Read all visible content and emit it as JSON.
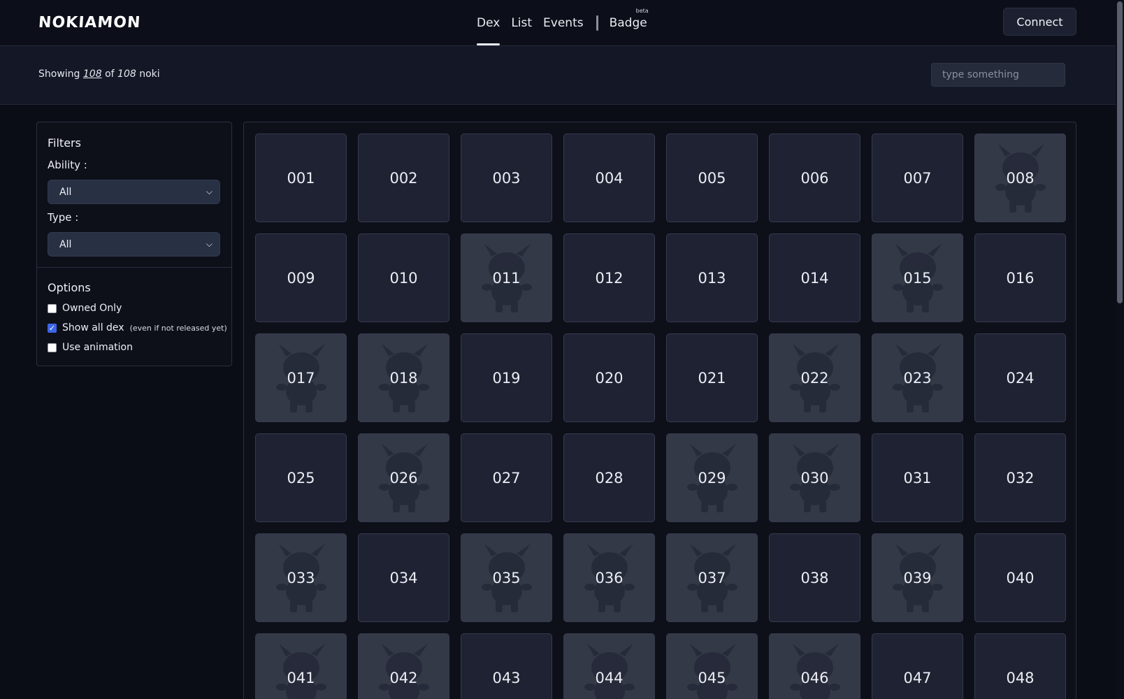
{
  "header": {
    "logo": "NOKIAMON",
    "nav": [
      {
        "label": "Dex",
        "active": true
      },
      {
        "label": "List",
        "active": false
      },
      {
        "label": "Events",
        "active": false
      }
    ],
    "badge_label": "Badge",
    "badge_tag": "beta",
    "connect_label": "Connect"
  },
  "subbar": {
    "showing_prefix": "Showing",
    "shown_count": "108",
    "of_word": "of",
    "total_count": "108",
    "unit": "noki",
    "search_placeholder": "type something"
  },
  "filters": {
    "title": "Filters",
    "ability_label": "Ability :",
    "ability_value": "All",
    "type_label": "Type :",
    "type_value": "All",
    "options_title": "Options",
    "options": [
      {
        "label": "Owned Only",
        "checked": false,
        "note": ""
      },
      {
        "label": "Show all dex",
        "checked": true,
        "note": "(even if not released yet)"
      },
      {
        "label": "Use animation",
        "checked": false,
        "note": ""
      }
    ]
  },
  "cards": [
    {
      "num": "001",
      "silhouette": false
    },
    {
      "num": "002",
      "silhouette": false
    },
    {
      "num": "003",
      "silhouette": false
    },
    {
      "num": "004",
      "silhouette": false
    },
    {
      "num": "005",
      "silhouette": false
    },
    {
      "num": "006",
      "silhouette": false
    },
    {
      "num": "007",
      "silhouette": false
    },
    {
      "num": "008",
      "silhouette": true
    },
    {
      "num": "009",
      "silhouette": false
    },
    {
      "num": "010",
      "silhouette": false
    },
    {
      "num": "011",
      "silhouette": true
    },
    {
      "num": "012",
      "silhouette": false
    },
    {
      "num": "013",
      "silhouette": false
    },
    {
      "num": "014",
      "silhouette": false
    },
    {
      "num": "015",
      "silhouette": true
    },
    {
      "num": "016",
      "silhouette": false
    },
    {
      "num": "017",
      "silhouette": true
    },
    {
      "num": "018",
      "silhouette": true
    },
    {
      "num": "019",
      "silhouette": false
    },
    {
      "num": "020",
      "silhouette": false
    },
    {
      "num": "021",
      "silhouette": false
    },
    {
      "num": "022",
      "silhouette": true
    },
    {
      "num": "023",
      "silhouette": true
    },
    {
      "num": "024",
      "silhouette": false
    },
    {
      "num": "025",
      "silhouette": false
    },
    {
      "num": "026",
      "silhouette": true
    },
    {
      "num": "027",
      "silhouette": false
    },
    {
      "num": "028",
      "silhouette": false
    },
    {
      "num": "029",
      "silhouette": true
    },
    {
      "num": "030",
      "silhouette": true
    },
    {
      "num": "031",
      "silhouette": false
    },
    {
      "num": "032",
      "silhouette": false
    },
    {
      "num": "033",
      "silhouette": true
    },
    {
      "num": "034",
      "silhouette": false
    },
    {
      "num": "035",
      "silhouette": true
    },
    {
      "num": "036",
      "silhouette": true
    },
    {
      "num": "037",
      "silhouette": true
    },
    {
      "num": "038",
      "silhouette": false
    },
    {
      "num": "039",
      "silhouette": true
    },
    {
      "num": "040",
      "silhouette": false
    },
    {
      "num": "041",
      "silhouette": true
    },
    {
      "num": "042",
      "silhouette": true
    },
    {
      "num": "043",
      "silhouette": false
    },
    {
      "num": "044",
      "silhouette": true
    },
    {
      "num": "045",
      "silhouette": true
    },
    {
      "num": "046",
      "silhouette": true
    },
    {
      "num": "047",
      "silhouette": false
    },
    {
      "num": "048",
      "silhouette": false
    }
  ]
}
